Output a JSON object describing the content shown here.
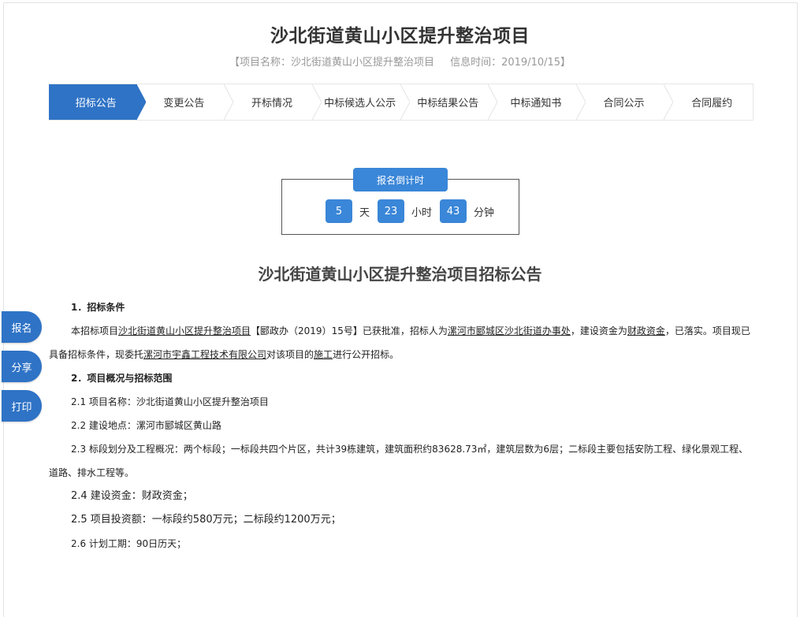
{
  "header": {
    "title": "沙北街道黄山小区提升整治项目",
    "project_meta": "【项目名称：沙北街道黄山小区提升整治项目",
    "info_time": "信息时间：2019/10/15】"
  },
  "steps": [
    {
      "label": "招标公告",
      "active": true
    },
    {
      "label": "变更公告",
      "active": false
    },
    {
      "label": "开标情况",
      "active": false
    },
    {
      "label": "中标候选人公示",
      "active": false
    },
    {
      "label": "中标结果公告",
      "active": false
    },
    {
      "label": "中标通知书",
      "active": false
    },
    {
      "label": "合同公示",
      "active": false
    },
    {
      "label": "合同履约",
      "active": false
    }
  ],
  "countdown": {
    "title": "报名倒计时",
    "days": "5",
    "days_unit": "天",
    "hours": "23",
    "hours_unit": "小时",
    "minutes": "43",
    "minutes_unit": "分钟"
  },
  "notice": {
    "title": "沙北街道黄山小区提升整治项目招标公告",
    "s1_heading": "1．招标条件",
    "s1_p_a": "本招标项目",
    "s1_p_link1": "沙北街道黄山小区提升整治项目",
    "s1_p_b": "【郾政办（2019）15号】已获批准，招标人为",
    "s1_p_link2": "漯河市郾城区沙北街道办事处",
    "s1_p_c": "，建设资金为",
    "s1_p_link3": "财政资金",
    "s1_p_d": "，已落实。项目现已具备招标条件，现委托",
    "s1_p_link4": "漯河市宇鑫工程技术有限公司",
    "s1_p_e": "对该项目的",
    "s1_p_link5": "施工",
    "s1_p_f": "进行公开招标。",
    "s2_heading": "2．项目概况与招标范围",
    "s2_1": "2.1 项目名称：沙北街道黄山小区提升整治项目",
    "s2_2": "2.2 建设地点：漯河市郾城区黄山路",
    "s2_3": "2.3 标段划分及工程概况：两个标段；一标段共四个片区，共计39栋建筑，建筑面积约83628.73㎡，建筑层数为6层；二标段主要包括安防工程、绿化景观工程、道路、排水工程等。",
    "s2_4": "2.4 建设资金：财政资金；",
    "s2_5": "2.5 项目投资额：一标段约580万元；二标段约1200万元；",
    "s2_6": "2.6 计划工期：90日历天；"
  },
  "side_buttons": {
    "signup": "报名",
    "share": "分享",
    "print": "打印"
  },
  "colors": {
    "accent": "#2f73c6",
    "countdown_blue": "#3a86d8"
  }
}
